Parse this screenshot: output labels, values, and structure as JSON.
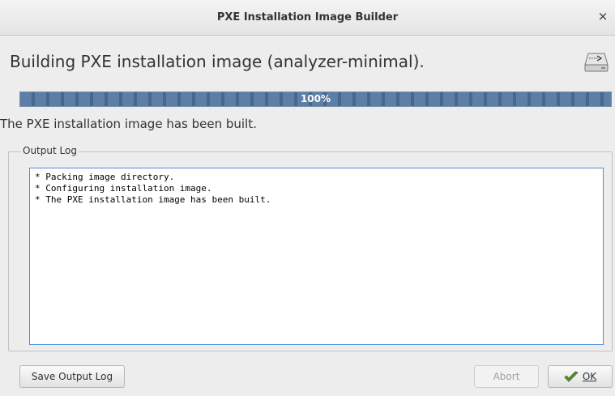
{
  "window": {
    "title": "PXE Installation Image Builder",
    "close_glyph": "×"
  },
  "heading": "Building PXE installation image (analyzer-minimal).",
  "heading_icon": "drive-icon",
  "progress": {
    "value": 1.0,
    "label": "100%"
  },
  "status": "The PXE installation image has been built.",
  "output_log": {
    "label": "Output Log",
    "lines": [
      "* Packing image directory.",
      "* Configuring installation image.",
      "* The PXE installation image has been built."
    ]
  },
  "buttons": {
    "save_log": "Save Output Log",
    "abort": "Abort",
    "ok": "OK"
  },
  "colors": {
    "progress_fill": "#4b719b",
    "focus_border": "#4a90d9",
    "ok_icon": "#5a8f2e"
  }
}
